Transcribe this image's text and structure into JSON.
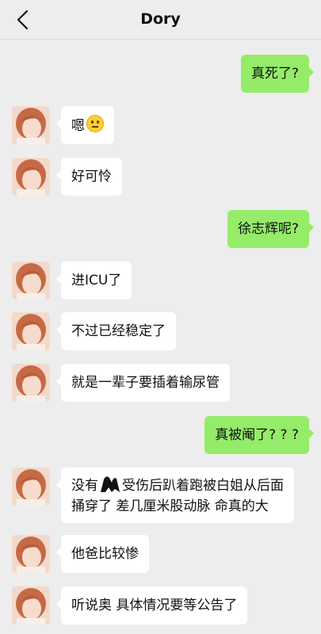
{
  "header": {
    "title": "Dory"
  },
  "messages": [
    {
      "side": "right",
      "text": "真死了?"
    },
    {
      "side": "left",
      "text": "嗯",
      "emoji": "neutral-face"
    },
    {
      "side": "left",
      "text": "好可怜"
    },
    {
      "side": "right",
      "text": "徐志辉呢?"
    },
    {
      "side": "left",
      "text": "进ICU了"
    },
    {
      "side": "left",
      "text": "不过已经稳定了"
    },
    {
      "side": "left",
      "text": "就是一辈子要插着输尿管"
    },
    {
      "side": "right",
      "text": "真被阉了? ? ?"
    },
    {
      "side": "left",
      "text_before": "没有",
      "text_after": "受伤后趴着跑被白姐从后面",
      "line2": "捅穿了 差几厘米股动脉 命真的大"
    },
    {
      "side": "left",
      "text": "他爸比较惨"
    },
    {
      "side": "left",
      "text": "听说奥 具体情况要等公告了"
    }
  ]
}
